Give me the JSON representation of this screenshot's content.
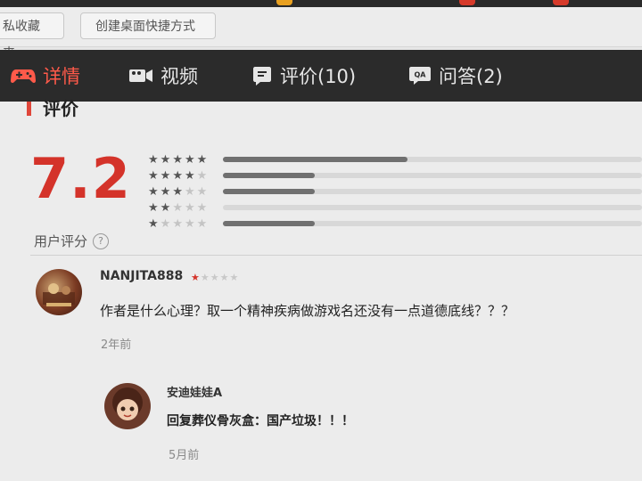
{
  "toolbar": {
    "bookmark_label": "私收藏夹",
    "shortcut_label": "创建桌面快捷方式"
  },
  "tabs": [
    {
      "label": "详情",
      "icon": "gamepad-icon",
      "active": true
    },
    {
      "label": "视频",
      "icon": "video-icon",
      "active": false
    },
    {
      "label": "评价(10)",
      "icon": "review-icon",
      "active": false
    },
    {
      "label": "问答(2)",
      "icon": "qa-icon",
      "active": false
    }
  ],
  "rating": {
    "section_title": "评价",
    "score": "7.2",
    "user_score_label": "用户评分",
    "distribution": [
      {
        "stars": 5,
        "fraction": 0.44
      },
      {
        "stars": 4,
        "fraction": 0.22
      },
      {
        "stars": 3,
        "fraction": 0.22
      },
      {
        "stars": 2,
        "fraction": 0.0
      },
      {
        "stars": 1,
        "fraction": 0.22
      }
    ]
  },
  "reviews": [
    {
      "username": "NANJITA888",
      "stars": 1,
      "text": "作者是什么心理？取一个精神疾病做游戏名还没有一点道德底线？？？",
      "time": "2年前",
      "reply": {
        "username": "安迪娃娃A",
        "text": "回复葬仪骨灰盒：国产垃圾！！！",
        "time": "5月前"
      }
    }
  ],
  "colors": {
    "accent": "#d4332a",
    "tab_bar": "#2b2b2b",
    "active_tab": "#ff5a4a"
  }
}
